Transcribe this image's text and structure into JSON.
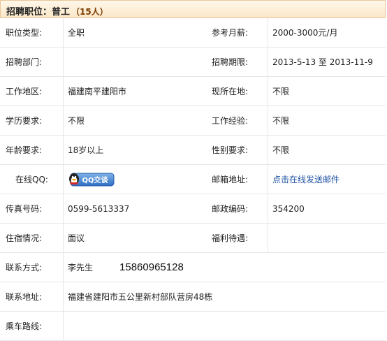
{
  "header": {
    "title_label": "招聘职位：",
    "job_name": "普工",
    "headcount": "（15人）"
  },
  "rows": [
    {
      "l1": "职位类型:",
      "v1": "全职",
      "l2": "参考月薪:",
      "v2": "2000-3000元/月"
    },
    {
      "l1": "招聘部门:",
      "v1": "",
      "l2": "招聘期限:",
      "v2": "2013-5-13 至 2013-11-9"
    },
    {
      "l1": "工作地区:",
      "v1": "福建南平建阳市",
      "l2": "现所在地:",
      "v2": "不限"
    },
    {
      "l1": "学历要求:",
      "v1": "不限",
      "l2": "工作经验:",
      "v2": "不限"
    },
    {
      "l1": "年龄要求:",
      "v1": "18岁以上",
      "l2": "性别要求:",
      "v2": "不限"
    },
    {
      "l1": "在线QQ:",
      "qq_button": "QQ交谈",
      "l2": "邮箱地址:",
      "v2": "点击在线发送邮件"
    },
    {
      "l1": "传真号码:",
      "v1": "0599-5613337",
      "l2": "邮政编码:",
      "v2": "354200"
    },
    {
      "l1": "住宿情况:",
      "v1": "面议",
      "l2": "福利待遇:",
      "v2": ""
    },
    {
      "l1": "联系方式:",
      "v1": "李先生",
      "phone": "15860965128"
    },
    {
      "l1": "联系地址:",
      "v1": "福建省建阳市五公里新村部队营房48栋"
    },
    {
      "l1": "乘车路线:",
      "v1": ""
    }
  ],
  "colors": {
    "header_border": "#e8c79a",
    "header_bg": "#fbe7c8",
    "link": "#1a4fa0",
    "divider": "#e6e6e6"
  },
  "icons": {
    "qq": "qq-penguin-icon"
  }
}
